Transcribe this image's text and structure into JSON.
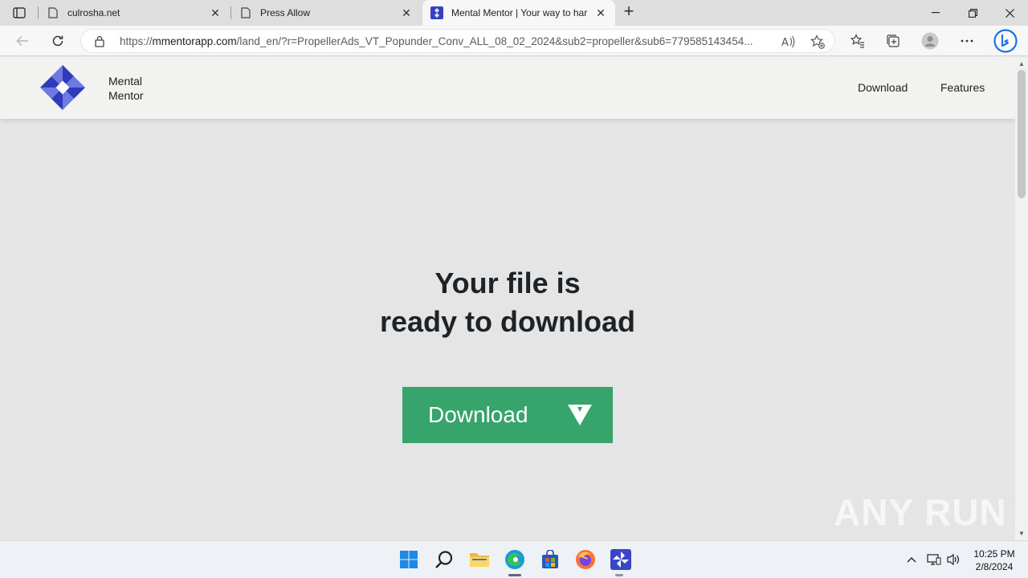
{
  "browser": {
    "tabs": [
      {
        "title": "culrosha.net",
        "icon": "page-icon"
      },
      {
        "title": "Press Allow",
        "icon": "page-icon"
      },
      {
        "title": "Mental Mentor | Your way to har",
        "icon": "mental-mentor-favicon"
      }
    ],
    "active_tab_index": 2,
    "address": {
      "scheme": "https://",
      "host": "mmentorapp.com",
      "path": "/land_en/?r=PropellerAds_VT_Popunder_Conv_ALL_08_02_2024&sub2=propeller&sub6=779585143454..."
    }
  },
  "site": {
    "brand_line1": "Mental",
    "brand_line2": "Mentor",
    "nav": [
      "Download",
      "Features"
    ],
    "hero_line1": "Your file is",
    "hero_line2": "ready to download",
    "download_button": "Download",
    "accent_color": "#37a46c",
    "logo_color": "#2e3bbd"
  },
  "watermark": "ANY RUN",
  "taskbar": {
    "apps": [
      "start-icon",
      "search-icon",
      "file-explorer-icon",
      "edge-icon",
      "store-icon",
      "firefox-icon",
      "mental-mentor-icon"
    ],
    "time": "10:25 PM",
    "date": "2/8/2024"
  }
}
